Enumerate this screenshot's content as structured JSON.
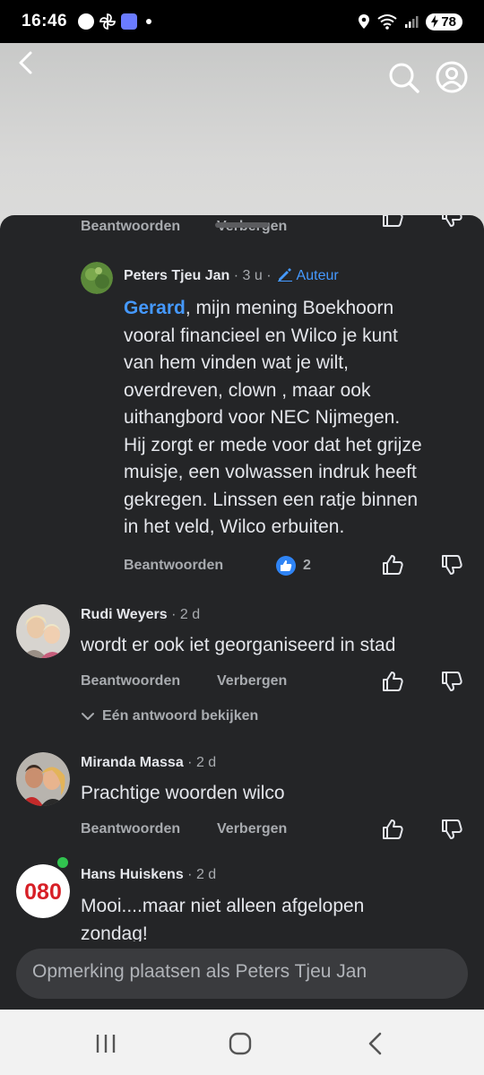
{
  "status_bar": {
    "time": "16:46",
    "battery": "78",
    "left_icons": [
      "cbs-news-icon",
      "pinwheel-icon",
      "calendar-app-icon",
      "notification-dot"
    ],
    "right_icons": [
      "location-icon",
      "wifi-icon",
      "signal-icon",
      "battery-icon"
    ]
  },
  "top_nav": {
    "back_icon": "chevron-left-icon",
    "search_icon": "search-icon",
    "profile_icon": "profile-icon"
  },
  "partial_row": {
    "reply_label": "Beantwoorden",
    "hide_label": "Verbergen"
  },
  "comments": [
    {
      "author": "Peters Tjeu Jan",
      "time": "· 3 u ·",
      "badge": "Auteur",
      "mention": "Gerard",
      "text_lines": [
        ", mijn mening Boekhoorn",
        "vooral financieel en Wilco je kunt",
        "van hem vinden wat je wilt,",
        "overdreven, clown , maar ook",
        "uithangbord voor NEC Nijmegen.",
        "Hij zorgt er mede voor dat het grijze",
        "muisje, een volwassen indruk heeft",
        "gekregen. Linssen een ratje binnen",
        "in het veld, Wilco erbuiten."
      ],
      "reply_label": "Beantwoorden",
      "like_count": "2"
    },
    {
      "author": "Rudi Weyers",
      "time": "· 2 d",
      "text": "wordt er ook iet georganiseerd in stad",
      "reply_label": "Beantwoorden",
      "hide_label": "Verbergen",
      "view_replies": "Eén antwoord bekijken"
    },
    {
      "author": "Miranda Massa",
      "time": "· 2 d",
      "text": "Prachtige woorden wilco",
      "reply_label": "Beantwoorden",
      "hide_label": "Verbergen"
    },
    {
      "author": "Hans Huiskens",
      "time": "· 2 d",
      "text_line1": "Mooi....maar niet alleen afgelopen",
      "text_line2": "zondag!",
      "avatar_text": "080"
    }
  ],
  "composer": {
    "placeholder": "Opmerking plaatsen als Peters Tjeu Jan"
  },
  "colors": {
    "sheet_bg": "#242527",
    "text": "#e4e6eb",
    "secondary": "#a8abaf",
    "link": "#4599ff",
    "like_blue": "#2f84f5"
  }
}
